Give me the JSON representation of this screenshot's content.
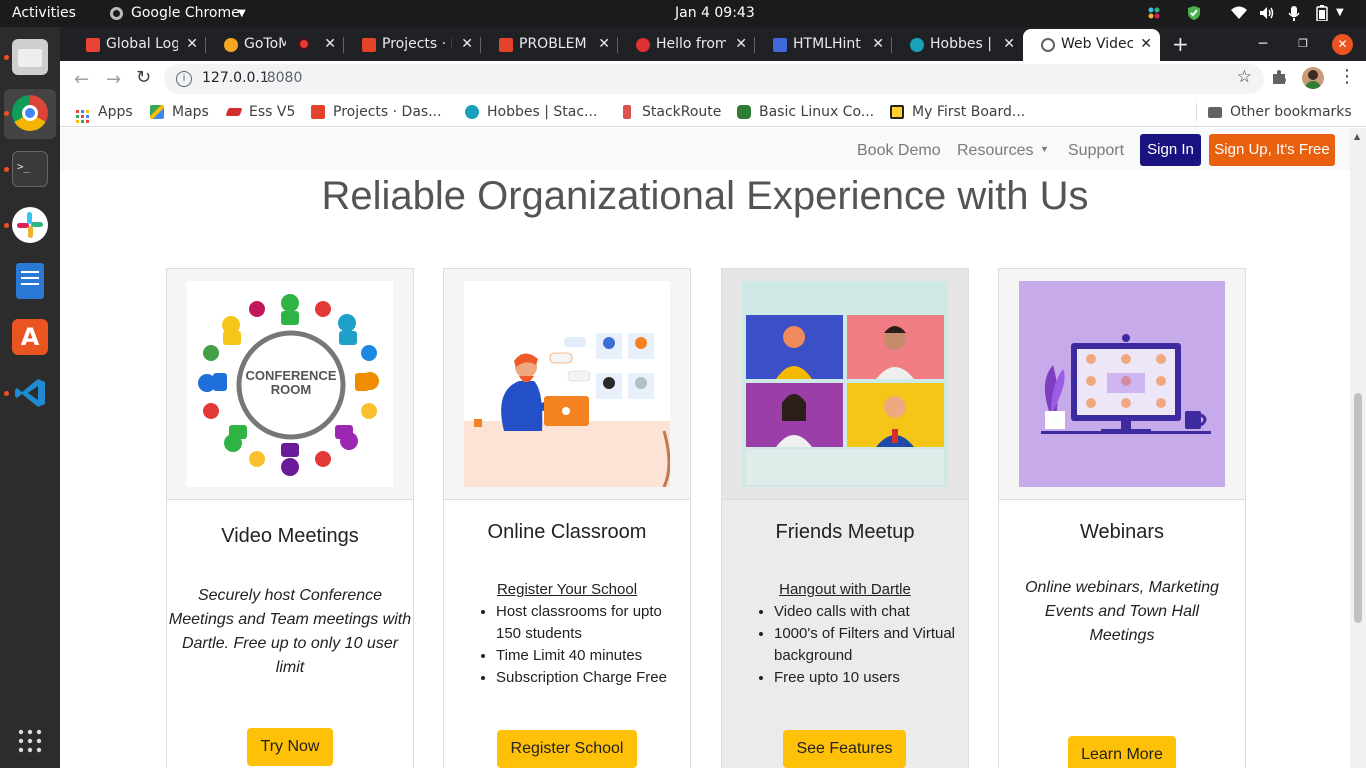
{
  "system": {
    "activities": "Activities",
    "app_menu": "Google Chrome",
    "clock": "Jan 4  09:43"
  },
  "tabs": [
    {
      "title": "Global Log",
      "color": "#ea4335"
    },
    {
      "title": "GoToM",
      "color": "#f5a623"
    },
    {
      "title": "Projects · D",
      "color": "#e24329"
    },
    {
      "title": "PROBLEM",
      "color": "#e24329"
    },
    {
      "title": "Hello from",
      "color": "#e03131"
    },
    {
      "title": "HTMLHint",
      "color": "#3f6ad8"
    },
    {
      "title": "Hobbes | S",
      "color": "#17a2b8"
    },
    {
      "title": "Web Videc",
      "color": "#5f6368"
    }
  ],
  "address": {
    "host": "127.0.0.1",
    "port": ":8080"
  },
  "bookmarks": [
    {
      "label": "Apps",
      "color": "#ea4335"
    },
    {
      "label": "Maps",
      "color": "#34a853"
    },
    {
      "label": "Ess V5",
      "color": "#d62b2b"
    },
    {
      "label": "Projects · Das...",
      "color": "#e24329"
    },
    {
      "label": "Hobbes | Stac...",
      "color": "#17a2b8"
    },
    {
      "label": "StackRoute",
      "color": "#d9534f"
    },
    {
      "label": "Basic Linux Co...",
      "color": "#2e7d32"
    },
    {
      "label": "My First Board...",
      "color": "#222222"
    }
  ],
  "other_bookmarks": "Other bookmarks",
  "site": {
    "nav": {
      "book_demo": "Book Demo",
      "resources": "Resources",
      "support": "Support",
      "sign_in": "Sign In",
      "sign_up": "Sign Up, It's Free"
    },
    "headline": "Reliable Organizational Experience with Us",
    "cards": [
      {
        "title": "Video Meetings",
        "description": "Securely host Conference Meetings and Team meetings with Dartle. Free up to only 10 user limit",
        "button": "Try Now",
        "image_text": "CONFERENCE ROOM"
      },
      {
        "title": "Online Classroom",
        "link": "Register Your School",
        "features": [
          "Host classrooms for upto 150 students",
          "Time Limit 40 minutes",
          "Subscription Charge Free"
        ],
        "button": "Register School"
      },
      {
        "title": "Friends Meetup",
        "link": "Hangout with Dartle",
        "features": [
          "Video calls with chat",
          "1000's of Filters and Virtual background",
          "Free upto 10 users"
        ],
        "button": "See Features"
      },
      {
        "title": "Webinars",
        "description": "Online webinars, Marketing Events and Town Hall Meetings",
        "button": "Learn More"
      }
    ]
  },
  "colors": {
    "sign_in_bg": "#1a1280",
    "sign_up_bg": "#e9600f",
    "card_button": "#ffc107"
  }
}
